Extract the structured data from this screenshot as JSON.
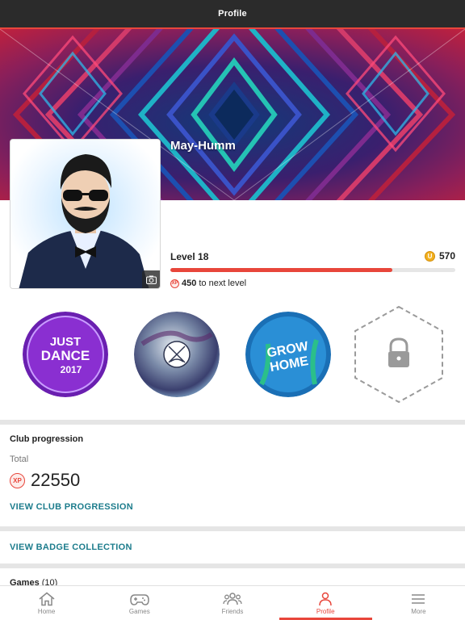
{
  "header": {
    "title": "Profile"
  },
  "profile": {
    "username": "May-Humm",
    "level_label": "Level 18",
    "coins": "570",
    "coin_icon": "coin-icon",
    "progress": 0.78,
    "next_level_xp": "450",
    "next_level_text": "to next level"
  },
  "badges": [
    {
      "name": "just-dance-2017",
      "text_line1": "JUST",
      "text_line2": "DANCE",
      "text_line3": "2017"
    },
    {
      "name": "steep-style"
    },
    {
      "name": "grow-home",
      "text_line1": "GROW",
      "text_line2": "HOME"
    },
    {
      "name": "locked",
      "icon": "lock-icon"
    }
  ],
  "club": {
    "title": "Club progression",
    "total_label": "Total",
    "xp_badge": "XP",
    "total_xp": "22550",
    "link": "VIEW CLUB PROGRESSION"
  },
  "badge_collection": {
    "link": "VIEW BADGE COLLECTION"
  },
  "games": {
    "title": "Games",
    "count": "(10)"
  },
  "nav": [
    {
      "label": "Home",
      "icon": "home-icon"
    },
    {
      "label": "Games",
      "icon": "gamepad-icon"
    },
    {
      "label": "Friends",
      "icon": "friends-icon"
    },
    {
      "label": "Profile",
      "icon": "profile-icon",
      "active": true
    },
    {
      "label": "More",
      "icon": "menu-icon"
    }
  ],
  "colors": {
    "accent": "#e8463b",
    "link": "#1c7c8c",
    "topbar": "#2b2b2b",
    "coin": "#f2b01e"
  }
}
